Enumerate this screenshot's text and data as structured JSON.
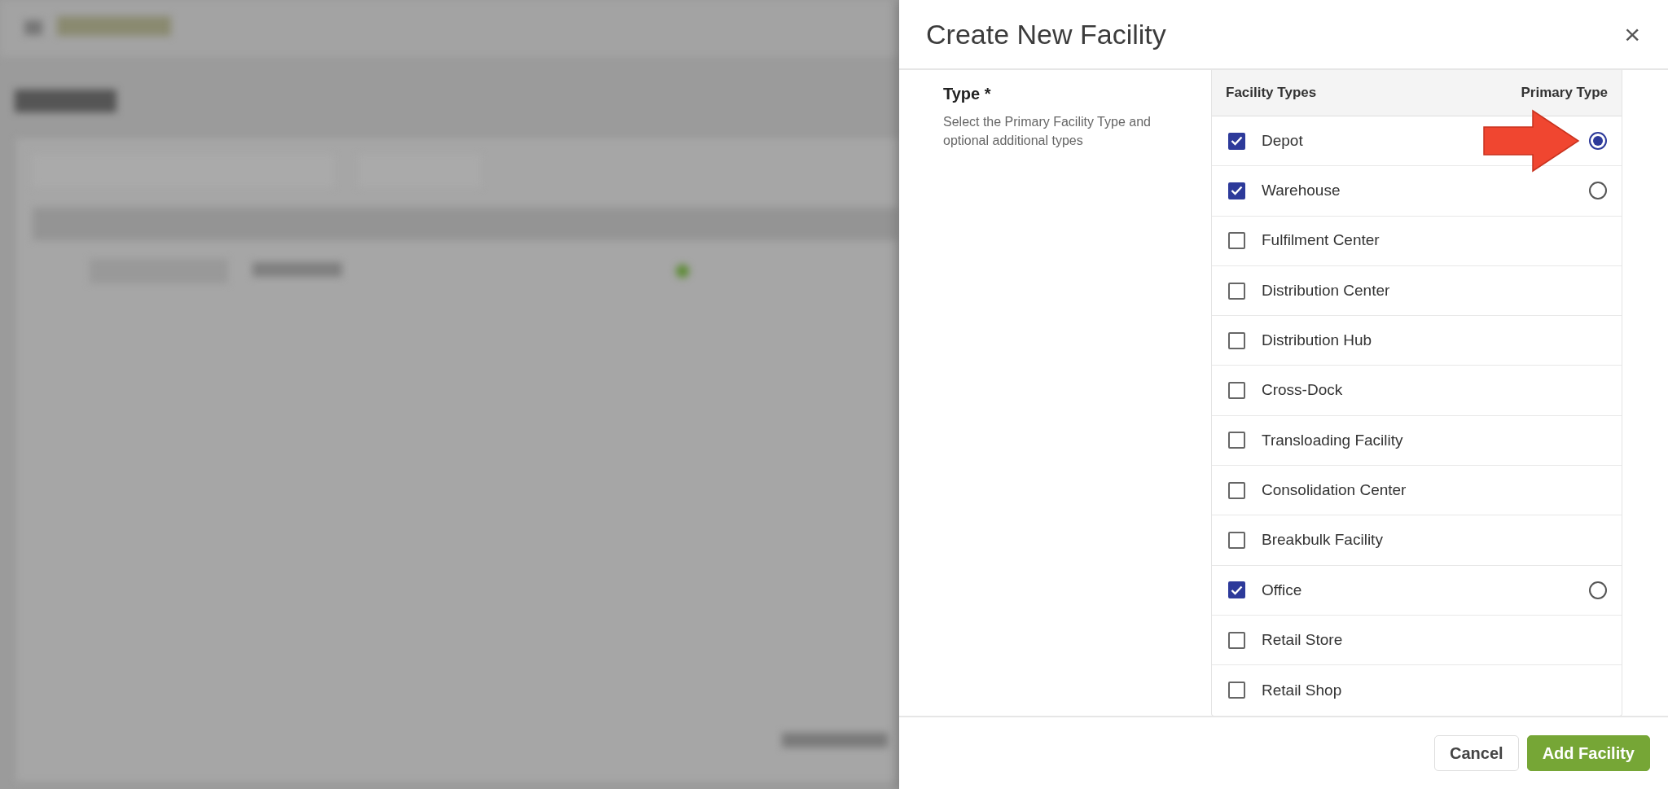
{
  "dialog": {
    "title": "Create New Facility",
    "close": "×"
  },
  "type_field": {
    "label": "Type *",
    "help": "Select the Primary Facility Type and optional additional types"
  },
  "table": {
    "columns": [
      "Facility Types",
      "Primary Type"
    ],
    "rows": [
      {
        "label": "Depot",
        "checked": true,
        "selected": true
      },
      {
        "label": "Warehouse",
        "checked": true,
        "selected": false
      },
      {
        "label": "Fulfilment Center",
        "checked": false
      },
      {
        "label": "Distribution Center",
        "checked": false
      },
      {
        "label": "Distribution Hub",
        "checked": false
      },
      {
        "label": "Cross-Dock",
        "checked": false
      },
      {
        "label": "Transloading Facility",
        "checked": false
      },
      {
        "label": "Consolidation Center",
        "checked": false
      },
      {
        "label": "Breakbulk Facility",
        "checked": false
      },
      {
        "label": "Office",
        "checked": true,
        "selected": false
      },
      {
        "label": "Retail Store",
        "checked": false
      },
      {
        "label": "Retail Shop",
        "checked": false
      }
    ]
  },
  "footer": {
    "buttons": [
      {
        "label": "Cancel",
        "kind": "secondary"
      },
      {
        "label": "Add Facility",
        "kind": "primary"
      }
    ]
  }
}
